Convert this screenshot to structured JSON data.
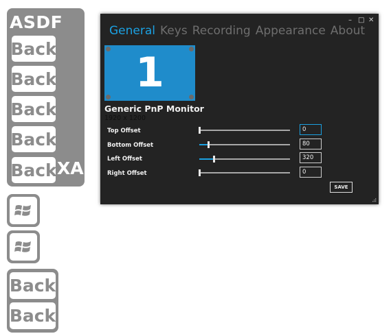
{
  "overlay": {
    "title": "ASDF",
    "keys": [
      "Back",
      "Back",
      "Back",
      "Back",
      "Back"
    ],
    "trailing_label": "XA",
    "stack_keys": [
      "Back",
      "Back"
    ],
    "win_icon": "windows-logo-icon"
  },
  "window": {
    "caption": {
      "minimize": "–",
      "maximize": "□",
      "close": "✕"
    },
    "tabs": [
      "General",
      "Keys",
      "Recording",
      "Appearance",
      "About"
    ],
    "active_tab": "General",
    "monitor": {
      "number": "1",
      "name": "Generic PnP Monitor",
      "resolution": "1920 x 1200"
    },
    "offsets": [
      {
        "label": "Top Offset",
        "value": "0",
        "level": 0.0
      },
      {
        "label": "Bottom Offset",
        "value": "80",
        "level": 0.1
      },
      {
        "label": "Left Offset",
        "value": "320",
        "level": 0.16
      },
      {
        "label": "Right Offset",
        "value": "0",
        "level": 0.0
      }
    ],
    "save_label": "SAVE"
  },
  "colors": {
    "accent": "#1ba1e2",
    "monitor": "#1f8ccb",
    "window_bg": "#232323",
    "overlay_gray": "#8c8c8c"
  }
}
